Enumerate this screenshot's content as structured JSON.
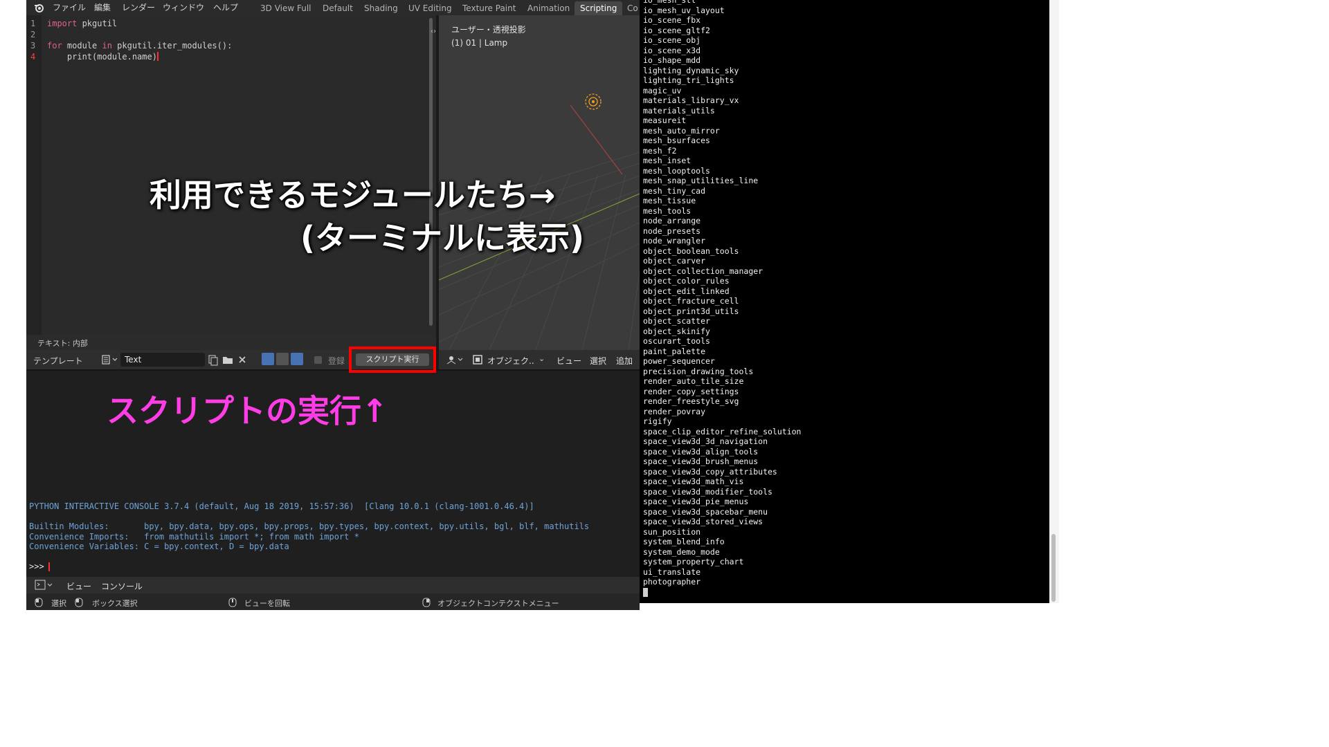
{
  "menubar": {
    "items": [
      "ファイル",
      "編集",
      "レンダー",
      "ウィンドウ",
      "ヘルプ"
    ],
    "workspaces": [
      "3D View Full",
      "Default",
      "Shading",
      "UV Editing",
      "Texture Paint",
      "Animation",
      "Scripting",
      "Co"
    ],
    "active_workspace": "Scripting"
  },
  "editor": {
    "line_numbers": [
      "1",
      "2",
      "3",
      "4"
    ],
    "lines": [
      {
        "kw": "import",
        "rest": " pkgutil"
      },
      {
        "kw": "",
        "rest": ""
      },
      {
        "kw": "for",
        "rest": " module ",
        "kw2": "in",
        "rest2": " pkgutil.iter_modules():"
      },
      {
        "kw": "",
        "rest": "    print(module.name)"
      }
    ],
    "footer_label": "テキスト: 内部"
  },
  "editor_header": {
    "template_label": "テンプレート",
    "text_name": "Text",
    "register_label": "登録",
    "run_script_label": "スクリプト実行"
  },
  "viewport": {
    "view_label": "ユーザー・透視投影",
    "object_label": "(1) 01 | Lamp",
    "mode_label": "オブジェク..",
    "menu_view": "ビュー",
    "menu_select": "選択",
    "menu_add": "追加"
  },
  "console": {
    "lines": [
      "PYTHON INTERACTIVE CONSOLE 3.7.4 (default, Aug 18 2019, 15:57:36)  [Clang 10.0.1 (clang-1001.0.46.4)]",
      "",
      "Builtin Modules:       bpy, bpy.data, bpy.ops, bpy.props, bpy.types, bpy.context, bpy.utils, bgl, blf, mathutils",
      "Convenience Imports:   from mathutils import *; from math import *",
      "Convenience Variables: C = bpy.context, D = bpy.data"
    ],
    "prompt": ">>>",
    "header_view": "ビュー",
    "header_console": "コンソール"
  },
  "statusbar": {
    "select": "選択",
    "box_select": "ボックス選択",
    "rotate_view": "ビューを回転",
    "context_menu": "オブジェクトコンテクストメニュー"
  },
  "terminal": {
    "lines": [
      "io_mesh_stl",
      "io_mesh_uv_layout",
      "io_scene_fbx",
      "io_scene_gltf2",
      "io_scene_obj",
      "io_scene_x3d",
      "io_shape_mdd",
      "lighting_dynamic_sky",
      "lighting_tri_lights",
      "magic_uv",
      "materials_library_vx",
      "materials_utils",
      "measureit",
      "mesh_auto_mirror",
      "mesh_bsurfaces",
      "mesh_f2",
      "mesh_inset",
      "mesh_looptools",
      "mesh_snap_utilities_line",
      "mesh_tiny_cad",
      "mesh_tissue",
      "mesh_tools",
      "node_arrange",
      "node_presets",
      "node_wrangler",
      "object_boolean_tools",
      "object_carver",
      "object_collection_manager",
      "object_color_rules",
      "object_edit_linked",
      "object_fracture_cell",
      "object_print3d_utils",
      "object_scatter",
      "object_skinify",
      "oscurart_tools",
      "paint_palette",
      "power_sequencer",
      "precision_drawing_tools",
      "render_auto_tile_size",
      "render_copy_settings",
      "render_freestyle_svg",
      "render_povray",
      "rigify",
      "space_clip_editor_refine_solution",
      "space_view3d_3d_navigation",
      "space_view3d_align_tools",
      "space_view3d_brush_menus",
      "space_view3d_copy_attributes",
      "space_view3d_math_vis",
      "space_view3d_modifier_tools",
      "space_view3d_pie_menus",
      "space_view3d_spacebar_menu",
      "space_view3d_stored_views",
      "sun_position",
      "system_blend_info",
      "system_demo_mode",
      "system_property_chart",
      "ui_translate",
      "photographer"
    ]
  },
  "annotations": {
    "modules_line1": "利用できるモジュールたち→",
    "modules_line2": "(ターミナルに表示)",
    "run_script": "スクリプトの実行↑"
  },
  "colors": {
    "highlight_red": "#ff0000",
    "annotation_magenta": "#ff3de6",
    "console_text": "#6fa3d8",
    "active_workspace": "#474747"
  }
}
